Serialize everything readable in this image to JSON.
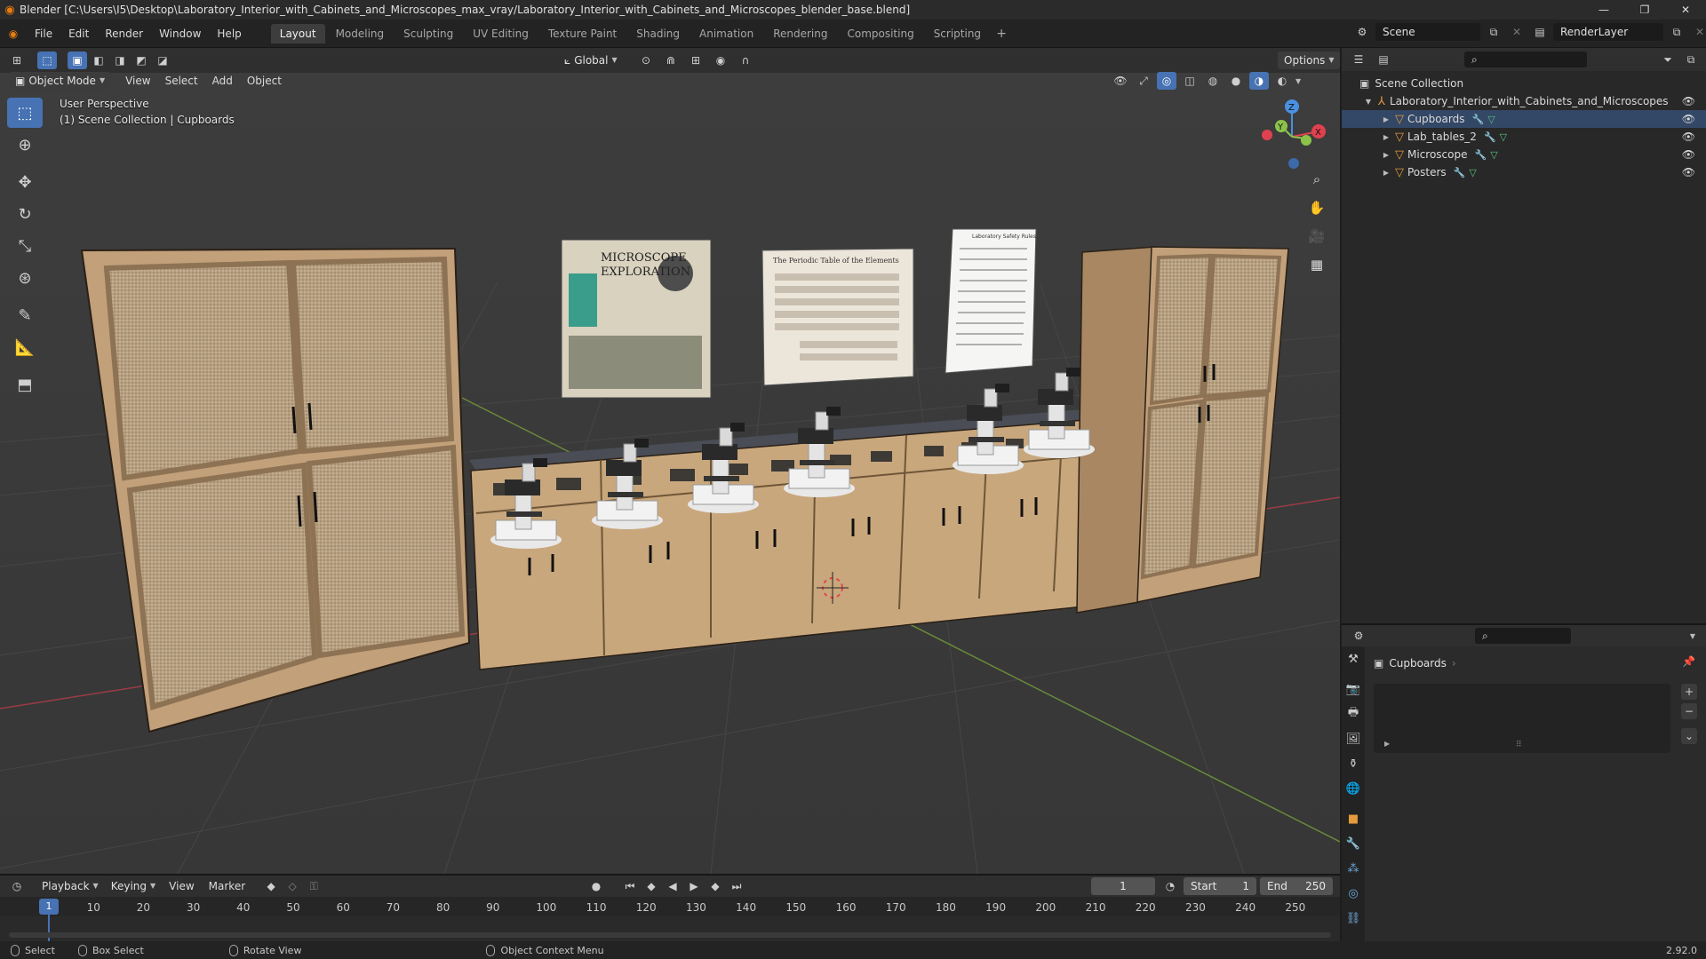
{
  "window": {
    "title": "Blender [C:\\Users\\I5\\Desktop\\Laboratory_Interior_with_Cabinets_and_Microscopes_max_vray/Laboratory_Interior_with_Cabinets_and_Microscopes_blender_base.blend]",
    "logo_icon": "blender-logo-icon"
  },
  "menu": [
    "File",
    "Edit",
    "Render",
    "Window",
    "Help"
  ],
  "workspaces": {
    "active": "Layout",
    "tabs": [
      "Layout",
      "Modeling",
      "Sculpting",
      "UV Editing",
      "Texture Paint",
      "Shading",
      "Animation",
      "Rendering",
      "Compositing",
      "Scripting"
    ]
  },
  "scene": {
    "name": "Scene",
    "view_layer": "RenderLayer"
  },
  "viewport_header": {
    "mode": "Object Mode",
    "menus": [
      "View",
      "Select",
      "Add",
      "Object"
    ],
    "transform_orientation": "Global",
    "options_label": "Options"
  },
  "viewport": {
    "perspective_label": "User Perspective",
    "collection_label": "(1) Scene Collection | Cupboards",
    "gizmo": {
      "x": "X",
      "y": "Y",
      "z": "Z"
    },
    "posters": {
      "microscope_line1": "MICROSCOPE",
      "microscope_line2": "EXPLORATION",
      "periodic": "The Periodic Table of the Elements",
      "safety": "Laboratory Safety Rules"
    }
  },
  "outliner": {
    "root": "Scene Collection",
    "collection": "Laboratory_Interior_with_Cabinets_and_Microscopes",
    "objects": [
      "Cupboards",
      "Lab_tables_2",
      "Microscope",
      "Posters"
    ]
  },
  "properties": {
    "object_name": "Cupboards"
  },
  "timeline": {
    "menus": [
      "Playback",
      "Keying",
      "View",
      "Marker"
    ],
    "current_frame": "1",
    "start_label": "Start",
    "start": "1",
    "end_label": "End",
    "end": "250",
    "ticks": [
      "1",
      "10",
      "20",
      "30",
      "40",
      "50",
      "60",
      "70",
      "80",
      "90",
      "100",
      "110",
      "120",
      "130",
      "140",
      "150",
      "160",
      "170",
      "180",
      "190",
      "200",
      "210",
      "220",
      "230",
      "240",
      "250"
    ]
  },
  "statusbar": {
    "select": "Select",
    "box_select": "Box Select",
    "rotate_view": "Rotate View",
    "context_menu": "Object Context Menu",
    "version": "2.92.0"
  },
  "colors": {
    "accent": "#4772b3",
    "wood": "#c9a77d",
    "x_axis": "#e0414f",
    "y_axis": "#8bc34a",
    "z_axis": "#4a90e2"
  }
}
